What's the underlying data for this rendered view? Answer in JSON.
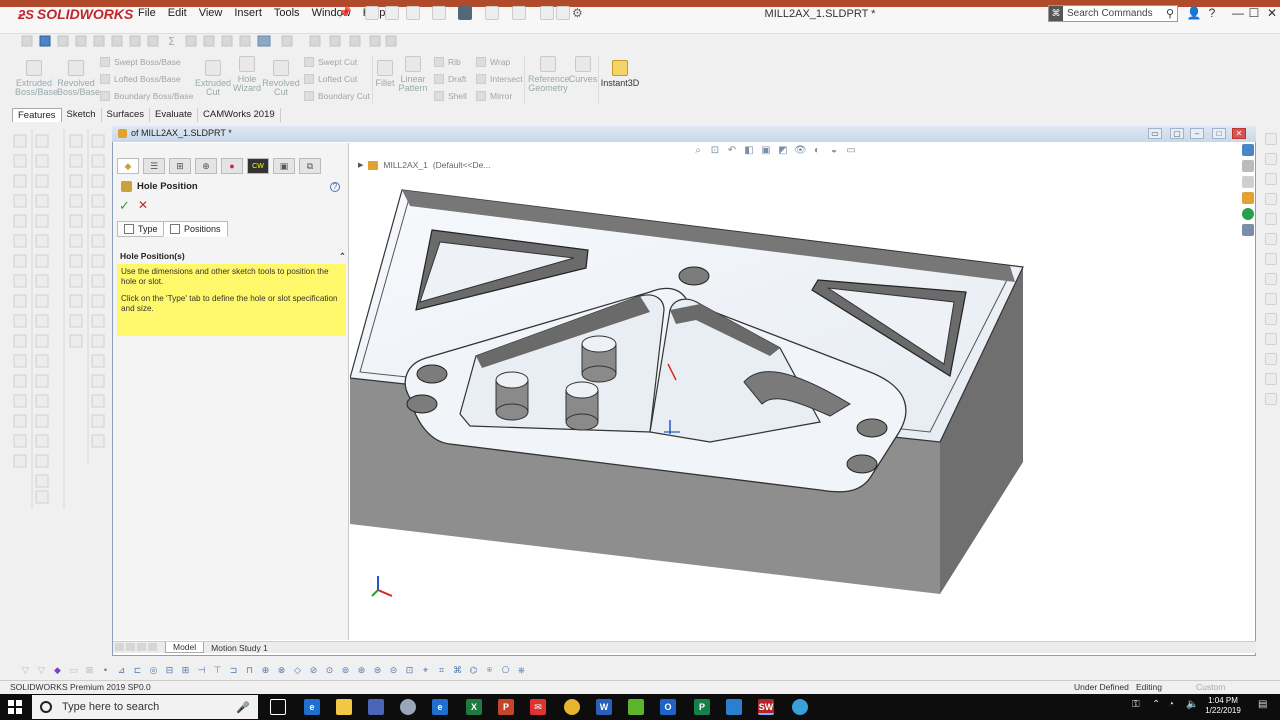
{
  "app": {
    "brand": "SOLIDWORKS",
    "document_title": "MILL2AX_1.SLDPRT *",
    "doc_tab_title": "of MILL2AX_1.SLDPRT *",
    "search_placeholder": "Search Commands",
    "menu": [
      "File",
      "Edit",
      "View",
      "Insert",
      "Tools",
      "Window",
      "Help"
    ]
  },
  "ribbon": {
    "large": [
      {
        "label": "Extruded Boss/Base",
        "name": "extruded-boss-base"
      },
      {
        "label": "Revolved Boss/Base",
        "name": "revolved-boss-base"
      },
      {
        "label": "Extruded Cut",
        "name": "extruded-cut"
      },
      {
        "label": "Hole Wizard",
        "name": "hole-wizard"
      },
      {
        "label": "Revolved Cut",
        "name": "revolved-cut"
      },
      {
        "label": "Fillet",
        "name": "fillet"
      },
      {
        "label": "Linear Pattern",
        "name": "linear-pattern"
      },
      {
        "label": "Reference Geometry",
        "name": "reference-geometry"
      },
      {
        "label": "Curves",
        "name": "curves"
      },
      {
        "label": "Instant3D",
        "name": "instant3d"
      }
    ],
    "small": [
      {
        "label": "Swept Boss/Base",
        "name": "swept-boss-base"
      },
      {
        "label": "Lofted Boss/Base",
        "name": "lofted-boss-base"
      },
      {
        "label": "Boundary Boss/Base",
        "name": "boundary-boss-base"
      },
      {
        "label": "Swept Cut",
        "name": "swept-cut"
      },
      {
        "label": "Lofted Cut",
        "name": "lofted-cut"
      },
      {
        "label": "Boundary Cut",
        "name": "boundary-cut"
      },
      {
        "label": "Rib",
        "name": "rib"
      },
      {
        "label": "Draft",
        "name": "draft"
      },
      {
        "label": "Shell",
        "name": "shell"
      },
      {
        "label": "Wrap",
        "name": "wrap"
      },
      {
        "label": "Intersect",
        "name": "intersect"
      },
      {
        "label": "Mirror",
        "name": "mirror"
      }
    ]
  },
  "command_tabs": [
    "Features",
    "Sketch",
    "Surfaces",
    "Evaluate",
    "CAMWorks 2019"
  ],
  "property_manager": {
    "title": "Hole Position",
    "tabs": [
      "Type",
      "Positions"
    ],
    "group_title": "Hole Position(s)",
    "message_1": "Use the dimensions and other sketch tools to position the hole or slot.",
    "message_2": "Click on the 'Type' tab to define the hole or slot specification and size."
  },
  "feature_tree": {
    "root": "MILL2AX_1",
    "config": "(Default<<De..."
  },
  "bottom_tabs": [
    "Model",
    "Motion Study 1"
  ],
  "status": {
    "product": "SOLIDWORKS Premium 2019 SP0.0",
    "sketch_state": "Under Defined",
    "mode": "Editing",
    "units": "Custom"
  },
  "taskbar": {
    "search_placeholder": "Type here to search",
    "time": "1:04 PM",
    "date": "1/22/2019"
  },
  "colors": {
    "brand_red": "#c0272d",
    "message_yellow": "#fff86b",
    "ok_green": "#2a9d38",
    "cancel_red": "#c42828",
    "model_gray": "#8c8c8c"
  }
}
